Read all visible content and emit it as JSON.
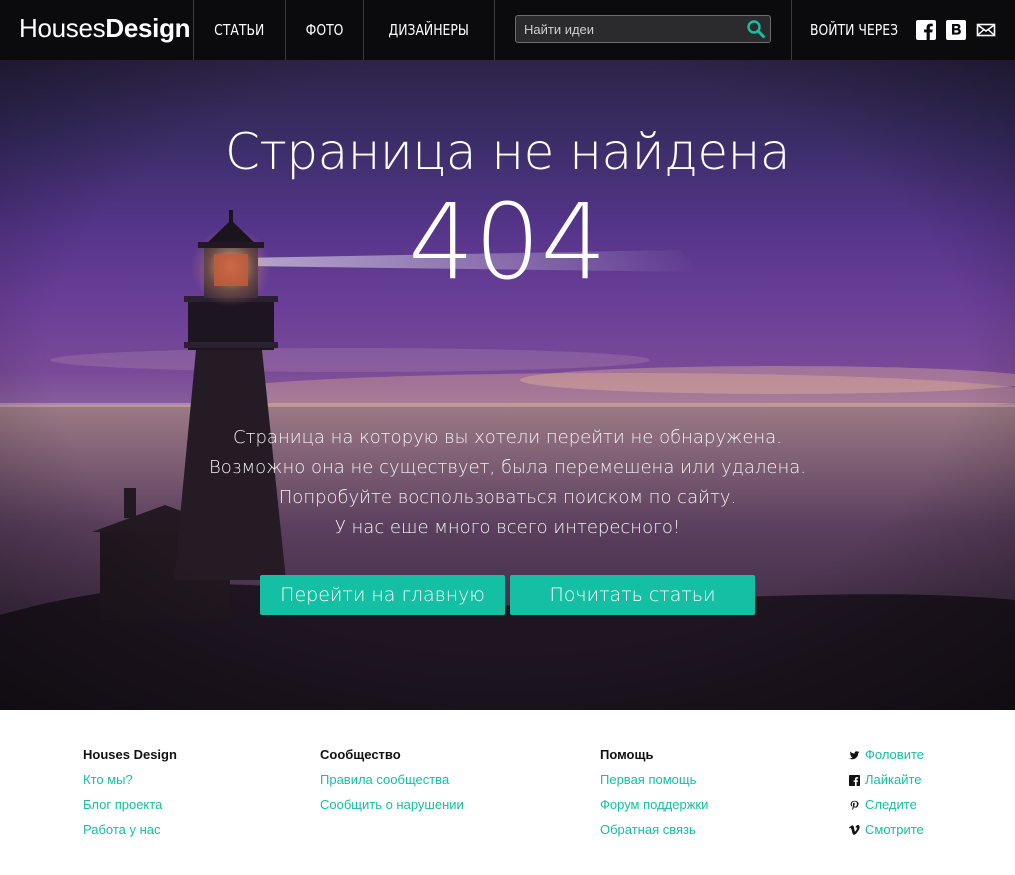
{
  "header": {
    "logo_light": "Houses",
    "logo_bold": "Design",
    "nav": [
      "СТАТЬИ",
      "ФОТО",
      "ДИЗАЙНЕРЫ"
    ],
    "search_placeholder": "Найти идеи",
    "login_label": "ВОЙТИ ЧЕРЕЗ",
    "social_icons": [
      "facebook-icon",
      "vk-icon",
      "mail-icon"
    ]
  },
  "hero": {
    "title": "Страница не найдена",
    "code": "404",
    "message": [
      "Страница на которую вы хотели перейти не обнаружена.",
      "Возможно она не существует, была перемешена или удалена.",
      "Попробуйте воспользоваться поиском по сайту.",
      "У нас еше много всего интересного!"
    ],
    "buttons": [
      "Перейти на главную",
      "Почитать статьи"
    ]
  },
  "footer": {
    "columns": [
      {
        "heading": "Houses Design",
        "links": [
          "Кто мы?",
          "Блог проекта",
          "Работа у нас"
        ]
      },
      {
        "heading": "Сообщество",
        "links": [
          "Правила сообщества",
          "Сообщить о нарушении"
        ]
      },
      {
        "heading": "Помощь",
        "links": [
          "Первая помощь",
          "Форум поддержки",
          "Обратная связь"
        ]
      }
    ],
    "social_links": [
      {
        "icon": "twitter-icon",
        "label": "Фоловите"
      },
      {
        "icon": "facebook-icon",
        "label": "Лайкайте"
      },
      {
        "icon": "pinterest-icon",
        "label": "Следите"
      },
      {
        "icon": "vimeo-icon",
        "label": "Смотрите"
      }
    ]
  },
  "colors": {
    "accent": "#14bfa3",
    "header_bg": "#0b0b0d"
  }
}
